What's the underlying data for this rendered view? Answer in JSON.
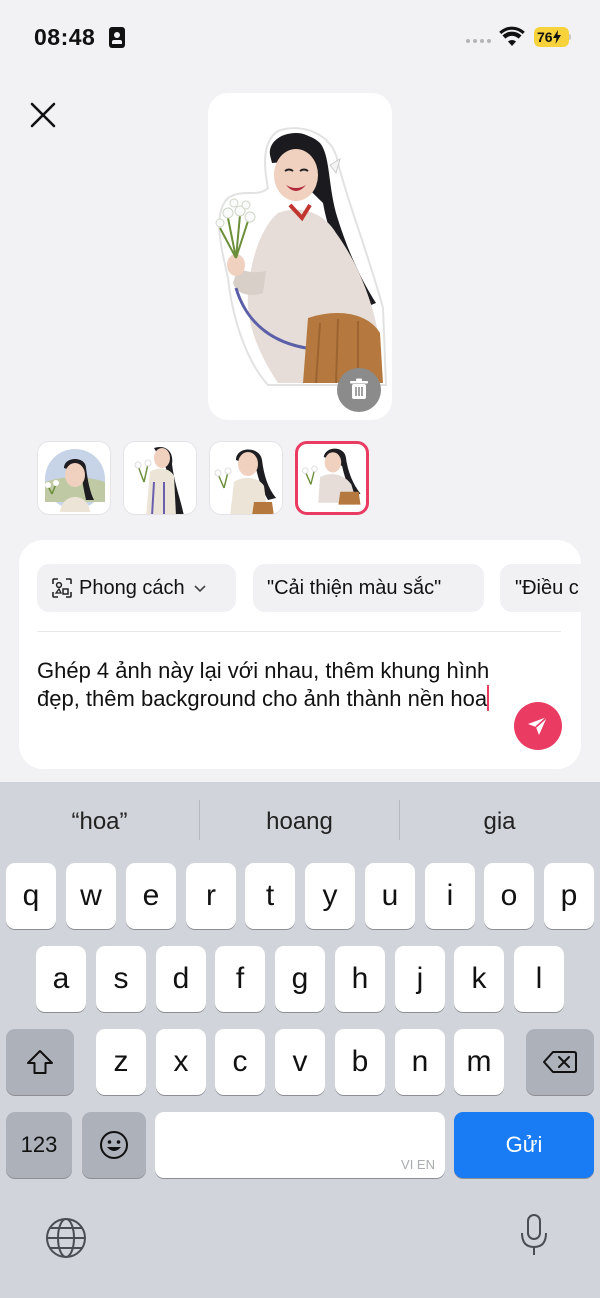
{
  "status_bar": {
    "time": "08:48",
    "battery": "76"
  },
  "preview": {
    "delete_icon": "trash-icon",
    "close_icon": "close-icon"
  },
  "thumbnails": [
    {
      "id": 1,
      "selected": false
    },
    {
      "id": 2,
      "selected": false
    },
    {
      "id": 3,
      "selected": false
    },
    {
      "id": 4,
      "selected": true
    }
  ],
  "prompt_card": {
    "chips": [
      {
        "label": "Phong cách",
        "icon": "style-icon",
        "dropdown": true
      },
      {
        "label": "\"Cải thiện màu sắc\""
      },
      {
        "label": "\"Điều c"
      }
    ],
    "prompt_text": "Ghép 4 ảnh này lại với nhau, thêm khung hình đẹp, thêm background cho ảnh thành nền hoa",
    "send_icon": "send-icon"
  },
  "keyboard": {
    "suggestions": [
      "“hoa”",
      "hoang",
      "gia"
    ],
    "row1": [
      "q",
      "w",
      "e",
      "r",
      "t",
      "y",
      "u",
      "i",
      "o",
      "p"
    ],
    "row2": [
      "a",
      "s",
      "d",
      "f",
      "g",
      "h",
      "j",
      "k",
      "l"
    ],
    "row3": [
      "z",
      "x",
      "c",
      "v",
      "b",
      "n",
      "m"
    ],
    "numbers_label": "123",
    "space_hint": "VI EN",
    "return_label": "Gửi"
  },
  "colors": {
    "accent": "#ea3b63",
    "keyboard_bg": "#d1d4da",
    "return_key": "#1a7cf5"
  }
}
